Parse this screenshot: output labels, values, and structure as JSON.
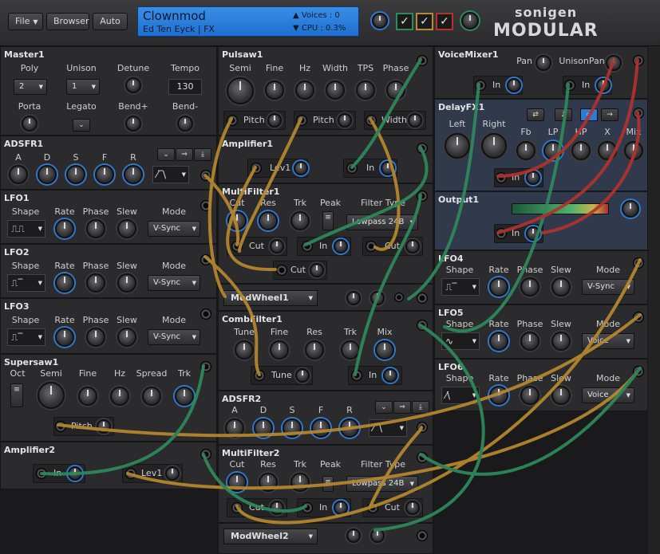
{
  "topbar": {
    "file": "File",
    "browser": "Browser",
    "auto": "Auto",
    "patch_name": "Clownmod",
    "author": "Ed Ten Eyck | FX",
    "voices_label": "Voices : 0",
    "cpu_label": "CPU     : 0.3%",
    "logo_top": "sonigen",
    "logo_bottom": "MODULAR"
  },
  "master": {
    "title": "Master1",
    "poly": "Poly",
    "unison": "Unison",
    "detune": "Detune",
    "tempo": "Tempo",
    "poly_value": "2",
    "unison_value": "1",
    "tempo_value": "130",
    "porta": "Porta",
    "legato": "Legato",
    "bendp": "Bend+",
    "bendm": "Bend-"
  },
  "adsfr1": {
    "title": "ADSFR1",
    "a": "A",
    "d": "D",
    "s": "S",
    "f": "F",
    "r": "R"
  },
  "lfo1": {
    "title": "LFO1",
    "shape": "Shape",
    "rate": "Rate",
    "phase": "Phase",
    "slew": "Slew",
    "mode": "Mode",
    "mode_value": "V-Sync"
  },
  "lfo2": {
    "title": "LFO2",
    "shape": "Shape",
    "rate": "Rate",
    "phase": "Phase",
    "slew": "Slew",
    "mode": "Mode",
    "mode_value": "V-Sync"
  },
  "lfo3": {
    "title": "LFO3",
    "shape": "Shape",
    "rate": "Rate",
    "phase": "Phase",
    "slew": "Slew",
    "mode": "Mode",
    "mode_value": "V-Sync"
  },
  "supersaw": {
    "title": "Supersaw1",
    "oct": "Oct",
    "semi": "Semi",
    "fine": "Fine",
    "hz": "Hz",
    "spread": "Spread",
    "trk": "Trk",
    "pitch": "Pitch"
  },
  "amp2": {
    "title": "Amplifier2",
    "in": "In",
    "lev": "Lev1"
  },
  "pulsaw": {
    "title": "Pulsaw1",
    "semi": "Semi",
    "fine": "Fine",
    "hz": "Hz",
    "width": "Width",
    "tps": "TPS",
    "phase": "Phase",
    "pitch1": "Pitch",
    "pitch2": "Pitch",
    "width2": "Width"
  },
  "amp1": {
    "title": "Amplifier1",
    "lev": "Lev1",
    "in": "In"
  },
  "mf1": {
    "title": "MultiFilter1",
    "cut": "Cut",
    "res": "Res",
    "trk": "Trk",
    "peak": "Peak",
    "ftype": "Filter Type",
    "ftype_value": "Lowpass 24B",
    "cut1": "Cut",
    "in": "In",
    "cut2": "Cut",
    "cut3": "Cut"
  },
  "mw1": {
    "title": "ModWheel1"
  },
  "comb": {
    "title": "CombFilter1",
    "tune": "Tune",
    "fine": "Fine",
    "res": "Res",
    "trk": "Trk",
    "mix": "Mix",
    "tune2": "Tune",
    "in": "In"
  },
  "adsfr2": {
    "title": "ADSFR2",
    "a": "A",
    "d": "D",
    "s": "S",
    "f": "F",
    "r": "R"
  },
  "mf2": {
    "title": "MultiFilter2",
    "cut": "Cut",
    "res": "Res",
    "trk": "Trk",
    "peak": "Peak",
    "ftype": "Filter Type",
    "ftype_value": "Lowpass 24B",
    "cut1": "Cut",
    "in": "In",
    "cut2": "Cut"
  },
  "mw2": {
    "title": "ModWheel2"
  },
  "vmix": {
    "title": "VoiceMixer1",
    "pan": "Pan",
    "upan": "UnisonPan",
    "in1": "In",
    "in2": "In"
  },
  "delay": {
    "title": "DelayFX1",
    "left": "Left",
    "right": "Right",
    "fb": "Fb",
    "lp": "LP",
    "hp": "HP",
    "x": "X",
    "mix": "Mix",
    "in": "In"
  },
  "output": {
    "title": "Output1",
    "in": "In"
  },
  "lfo4": {
    "title": "LFO4",
    "shape": "Shape",
    "rate": "Rate",
    "phase": "Phase",
    "slew": "Slew",
    "mode": "Mode",
    "mode_value": "V-Sync"
  },
  "lfo5": {
    "title": "LFO5",
    "shape": "Shape",
    "rate": "Rate",
    "phase": "Phase",
    "slew": "Slew",
    "mode": "Mode",
    "mode_value": "Voice"
  },
  "lfo6": {
    "title": "LFO6",
    "shape": "Shape",
    "rate": "Rate",
    "phase": "Phase",
    "slew": "Slew",
    "mode": "Mode",
    "mode_value": "Voice"
  },
  "colors": {
    "cable_gold": "#b8892e",
    "cable_green": "#2e8a5c",
    "cable_red": "#b3322e",
    "accent_blue": "#2d7ad0"
  }
}
